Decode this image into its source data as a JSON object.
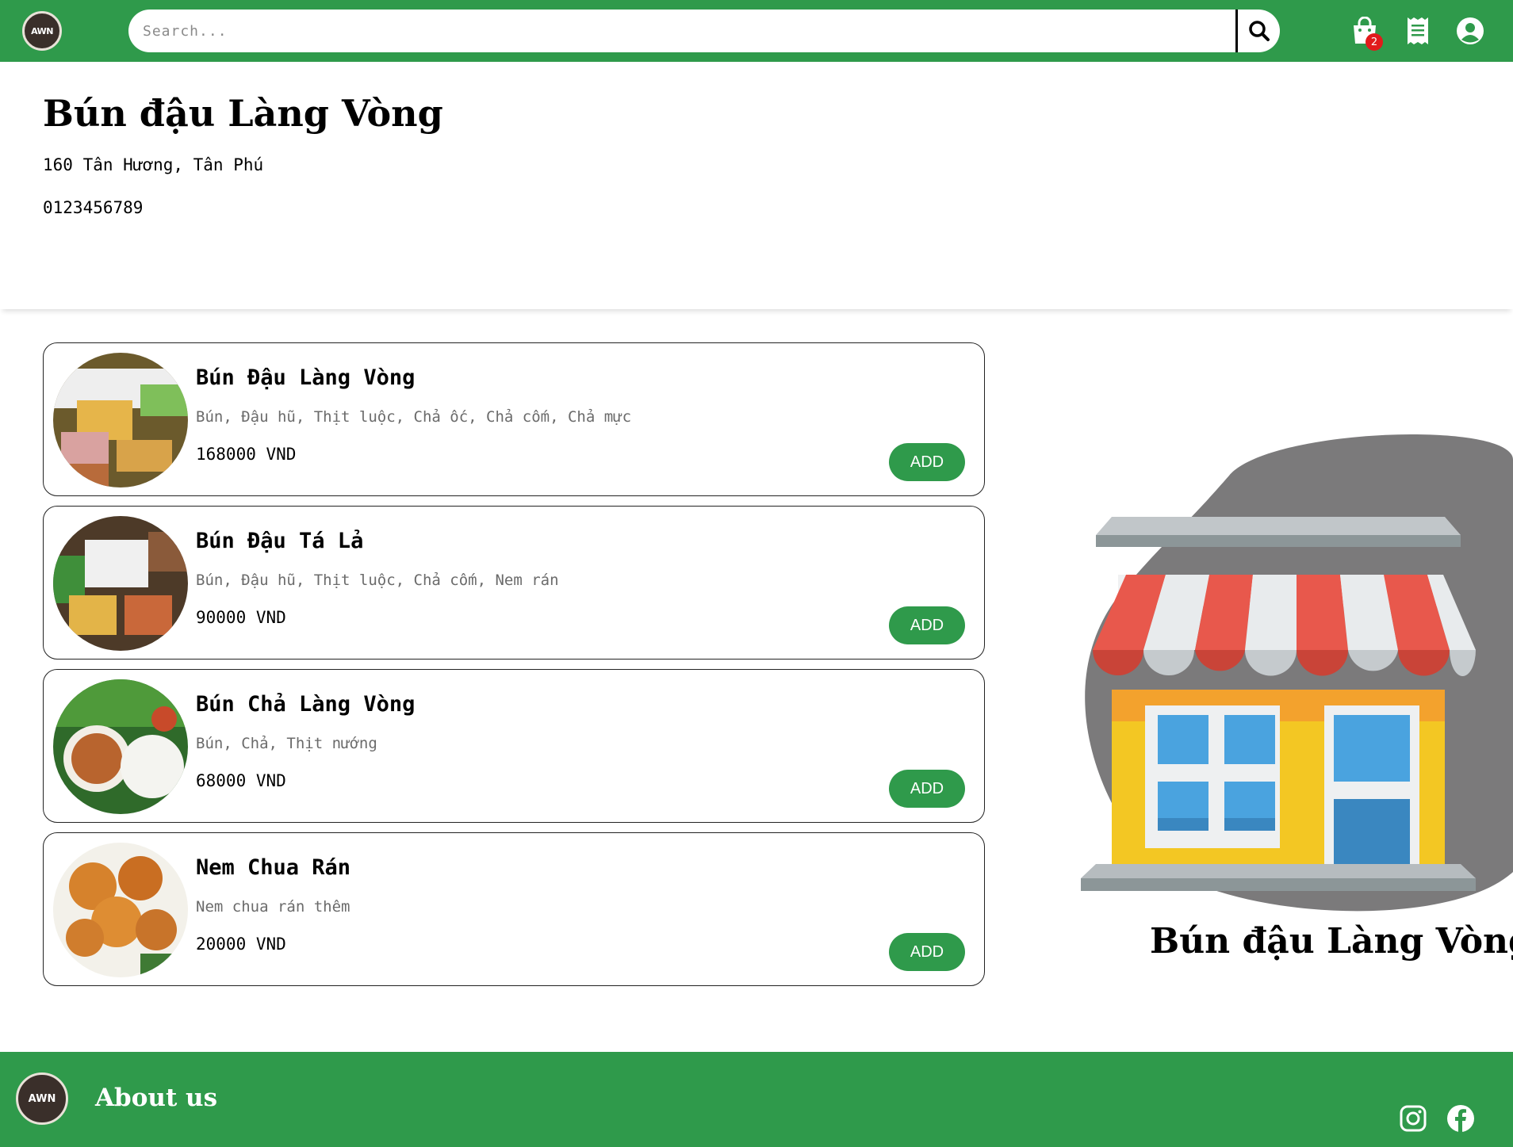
{
  "header": {
    "logo_text": "AWN",
    "search_placeholder": "Search...",
    "cart_count": "2"
  },
  "restaurant": {
    "name": "Bún đậu Làng Vòng",
    "address": "160 Tân Hương, Tân Phú",
    "phone": "0123456789"
  },
  "menu": [
    {
      "name": "Bún Đậu Làng Vòng",
      "desc": "Bún, Đậu hũ, Thịt luộc, Chả ốc, Chả cốm, Chả mực",
      "price": "168000 VND",
      "add_label": "ADD"
    },
    {
      "name": "Bún Đậu Tá Lả",
      "desc": "Bún, Đậu hũ, Thịt luộc, Chả cốm, Nem rán",
      "price": "90000 VND",
      "add_label": "ADD"
    },
    {
      "name": "Bún Chả Làng Vòng",
      "desc": "Bún, Chả, Thịt nướng",
      "price": "68000 VND",
      "add_label": "ADD"
    },
    {
      "name": "Nem Chua Rán",
      "desc": "Nem chua rán thêm",
      "price": "20000 VND",
      "add_label": "ADD"
    }
  ],
  "illustration": {
    "caption": "Bún đậu Làng Vòng"
  },
  "footer": {
    "logo_text": "AWN",
    "about_label": "About us"
  },
  "icons": {
    "cart": "shopping-bag-icon",
    "orders": "receipt-icon",
    "account": "user-circle-icon",
    "search": "search-icon",
    "instagram": "instagram-icon",
    "facebook": "facebook-icon"
  },
  "colors": {
    "brand_green": "#2f9a4b",
    "badge_red": "#e11b1b"
  }
}
